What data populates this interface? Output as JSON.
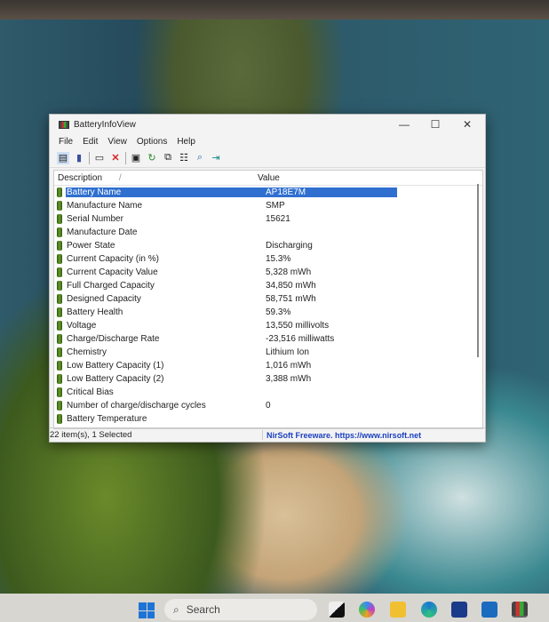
{
  "window": {
    "title": "BatteryInfoView",
    "minimize": "—",
    "maximize": "☐",
    "close": "✕"
  },
  "menu": [
    "File",
    "Edit",
    "View",
    "Options",
    "Help"
  ],
  "columns": {
    "description": "Description",
    "sort_indicator": "/",
    "value": "Value"
  },
  "rows": [
    {
      "d": "Battery Name",
      "v": "AP18E7M",
      "selected": true
    },
    {
      "d": "Manufacture Name",
      "v": "SMP"
    },
    {
      "d": "Serial Number",
      "v": "15621"
    },
    {
      "d": "Manufacture Date",
      "v": ""
    },
    {
      "d": "Power State",
      "v": "Discharging"
    },
    {
      "d": "Current Capacity (in %)",
      "v": "15.3%"
    },
    {
      "d": "Current Capacity Value",
      "v": "5,328 mWh"
    },
    {
      "d": "Full Charged Capacity",
      "v": "34,850 mWh"
    },
    {
      "d": "Designed Capacity",
      "v": "58,751 mWh"
    },
    {
      "d": "Battery Health",
      "v": "59.3%"
    },
    {
      "d": "Voltage",
      "v": "13,550 millivolts"
    },
    {
      "d": "Charge/Discharge Rate",
      "v": "-23,516 milliwatts"
    },
    {
      "d": "Chemistry",
      "v": "Lithium Ion"
    },
    {
      "d": "Low Battery Capacity (1)",
      "v": "1,016 mWh"
    },
    {
      "d": "Low Battery Capacity (2)",
      "v": "3,388 mWh"
    },
    {
      "d": "Critical Bias",
      "v": ""
    },
    {
      "d": "Number of charge/discharge cycles",
      "v": "0"
    },
    {
      "d": "Battery Temperature",
      "v": ""
    }
  ],
  "status": {
    "items": "22 item(s), 1 Selected",
    "link": "NirSoft Freeware. https://www.nirsoft.net"
  },
  "taskbar": {
    "search_placeholder": "Search"
  }
}
